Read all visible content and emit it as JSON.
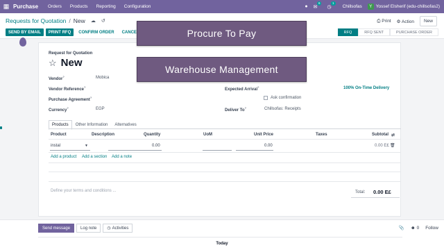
{
  "navbar": {
    "apps_icon": "grid-icon",
    "brand": "Purchase",
    "menus": [
      "Orders",
      "Products",
      "Reporting",
      "Configuration"
    ],
    "messages_count": "6",
    "activities_count": "1",
    "company": "Chillsofas",
    "user": "Yossef Elsherif (edu-chillsofas2)",
    "user_initial": "Y"
  },
  "breadcrumb": {
    "parent": "Requests for Quotation",
    "separator": "/",
    "current": "New"
  },
  "control": {
    "print": "Print",
    "action": "Action",
    "new": "New"
  },
  "actions": {
    "send_by_email": "Send by Email",
    "print_rfq": "Print RFQ",
    "confirm_order": "Confirm Order",
    "cancel": "Cancel"
  },
  "statusbar": [
    "RFQ",
    "RFQ Sent",
    "Purchase Order"
  ],
  "overlays": {
    "top": "Procure To Pay",
    "bottom": "Warehouse Management"
  },
  "form": {
    "doc_type": "Request for Quotation",
    "doc_name": "New",
    "vendor_label": "Vendor",
    "vendor_value": "Mobica",
    "vendor_ref_label": "Vendor Reference",
    "agreement_label": "Purchase Agreement",
    "currency_label": "Currency",
    "currency_value": "EGP",
    "expected_arrival_label": "Expected Arrival",
    "ask_confirmation_label": "Ask confirmation",
    "on_time": "100% On-Time Delivery",
    "deliver_to_label": "Deliver To",
    "deliver_to_value": "Chillsofas: Receipts",
    "help_mark": "?"
  },
  "tabs": [
    "Products",
    "Other Information",
    "Alternatives"
  ],
  "table": {
    "headers": [
      "Product",
      "Description",
      "Quantity",
      "UoM",
      "Unit Price",
      "Taxes",
      "Subtotal"
    ],
    "row": {
      "product": "instal",
      "quantity": "0.00",
      "unit_price": "0.00",
      "subtotal": "0.00 E£"
    },
    "add_product": "Add a product",
    "add_section": "Add a section",
    "add_note": "Add a note"
  },
  "terms_placeholder": "Define your terms and conditions ...",
  "totals": {
    "label": "Total:",
    "value": "0.00 E£"
  },
  "chatter": {
    "send_message": "Send message",
    "log_note": "Log note",
    "activities": "Activities",
    "followers_count": "0",
    "follow": "Follow",
    "today": "Today"
  },
  "colors": {
    "navbar": "#71639e",
    "primary": "#017e84",
    "overlay": "#6f5a80"
  }
}
